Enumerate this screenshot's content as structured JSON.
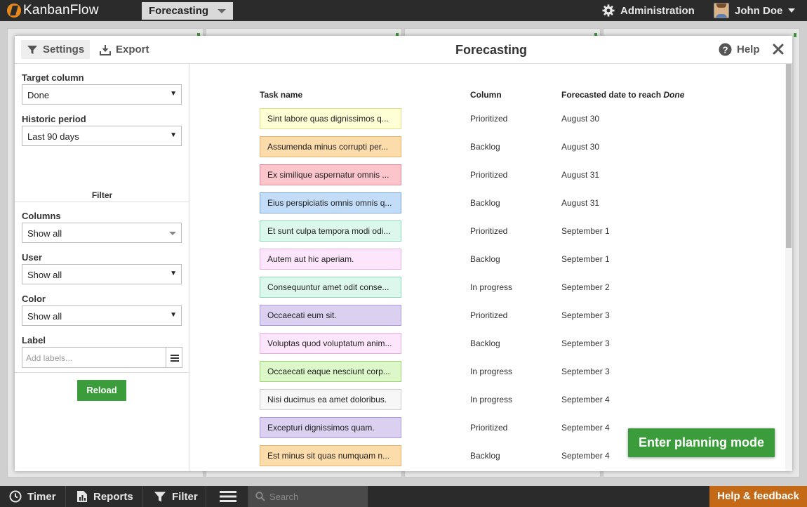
{
  "topbar": {
    "logo_text": "KanbanFlow",
    "board_name": "Forecasting",
    "admin_label": "Administration",
    "user_name": "John Doe"
  },
  "modal": {
    "settings_label": "Settings",
    "export_label": "Export",
    "title": "Forecasting",
    "help_label": "Help",
    "close_icon": "close-icon"
  },
  "sidebar": {
    "target_column_label": "Target column",
    "target_column_value": "Done",
    "historic_period_label": "Historic period",
    "historic_period_value": "Last 90 days",
    "filter_heading": "Filter",
    "columns_label": "Columns",
    "columns_value": "Show all",
    "user_label": "User",
    "user_value": "Show all",
    "color_label": "Color",
    "color_value": "Show all",
    "label_label": "Label",
    "label_placeholder": "Add labels...",
    "reload_label": "Reload"
  },
  "table": {
    "header_task": "Task name",
    "header_column": "Column",
    "header_date_prefix": "Forecasted date to reach ",
    "header_date_target": "Done",
    "rows": [
      {
        "task": "Sint labore quas dignissimos q...",
        "column": "Prioritized",
        "date": "August 30",
        "bg": "#ffffd6",
        "border": "#e0dc8a"
      },
      {
        "task": "Assumenda minus corrupti per...",
        "column": "Backlog",
        "date": "August 30",
        "bg": "#fddcac",
        "border": "#e3b46a"
      },
      {
        "task": "Ex similique aspernatur omnis ...",
        "column": "Prioritized",
        "date": "August 31",
        "bg": "#fcc5cc",
        "border": "#e08995"
      },
      {
        "task": "Eius perspiciatis omnis omnis q...",
        "column": "Backlog",
        "date": "August 31",
        "bg": "#c3dcf7",
        "border": "#7aa6d6"
      },
      {
        "task": "Et sunt culpa tempora modi odi...",
        "column": "Prioritized",
        "date": "September 1",
        "bg": "#dcf8ec",
        "border": "#8ed6b4"
      },
      {
        "task": "Autem aut hic aperiam.",
        "column": "Backlog",
        "date": "September 1",
        "bg": "#fde6fc",
        "border": "#e3b0e0"
      },
      {
        "task": "Consequuntur amet odit conse...",
        "column": "In progress",
        "date": "September 2",
        "bg": "#dcf8ec",
        "border": "#8ed6b4"
      },
      {
        "task": "Occaecati eum sit.",
        "column": "Prioritized",
        "date": "September 3",
        "bg": "#dcd0f0",
        "border": "#ad9ad6"
      },
      {
        "task": "Voluptas quod voluptatum anim...",
        "column": "Backlog",
        "date": "September 3",
        "bg": "#fde6fc",
        "border": "#e3b0e0"
      },
      {
        "task": "Occaecati eaque nesciunt corp...",
        "column": "In progress",
        "date": "September 3",
        "bg": "#dcf8c8",
        "border": "#9ed27a"
      },
      {
        "task": "Nisi ducimus ea amet doloribus.",
        "column": "In progress",
        "date": "September 4",
        "bg": "#f7f7f7",
        "border": "#cccccc"
      },
      {
        "task": "Excepturi dignissimos quam.",
        "column": "Prioritized",
        "date": "September 4",
        "bg": "#dcd0f0",
        "border": "#ad9ad6"
      },
      {
        "task": "Est minus sit quas numquam n...",
        "column": "Backlog",
        "date": "September 4",
        "bg": "#fddcac",
        "border": "#e3b46a"
      }
    ]
  },
  "planning_label": "Enter planning mode",
  "bottombar": {
    "timer_label": "Timer",
    "reports_label": "Reports",
    "filter_label": "Filter",
    "search_placeholder": "Search",
    "help_feedback_label": "Help & feedback"
  }
}
